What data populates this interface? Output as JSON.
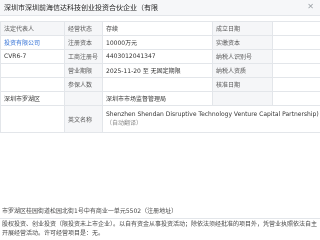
{
  "window": {
    "title": "深圳市深圳前海信达科技创业投资合伙企业（有限",
    "close_glyph": "✕"
  },
  "rows": [
    {
      "c1": "法定代表人",
      "c2": "经营状态",
      "c3": "存续",
      "c4": "成立日期",
      "c5": ""
    },
    {
      "c1": "投资有限公司",
      "c2": "注册资本",
      "c3": "10000万元",
      "c4": "实缴资本",
      "c5": ""
    },
    {
      "c1": "CVR6-7",
      "c2": "工商注册号",
      "c3": "4403012041347",
      "c4": "纳税人识别号",
      "c5": ""
    },
    {
      "c1": "",
      "c2": "营业期限",
      "c3": "2025-11-20 至 无固定期限",
      "c4": "纳税人资质",
      "c5": ""
    },
    {
      "c1": "",
      "c2": "参保人数",
      "c3": "",
      "c4": "核准日期",
      "c5": ""
    },
    {
      "c1": "深圳市罗湖区",
      "c2": "",
      "c3": "深圳市市场监督管理局",
      "c4": "",
      "c5": ""
    }
  ],
  "english_name_label": "英文名称",
  "english_name": "Shenzhen Shendan Disruptive Technology Venture Capital Partnership)",
  "english_name_note": "（自动翻译）",
  "address_line": "市罗湖区桂园街道松园北街1号中有商业一单元5502（注册地址）",
  "business_scope": "股权投资、创业投资（限投资未上市企业）。以自有资金从事投资活动；除依法须经批准的项目外，凭营业执照依法自主开展经营活动。许可经营项目是：无。"
}
